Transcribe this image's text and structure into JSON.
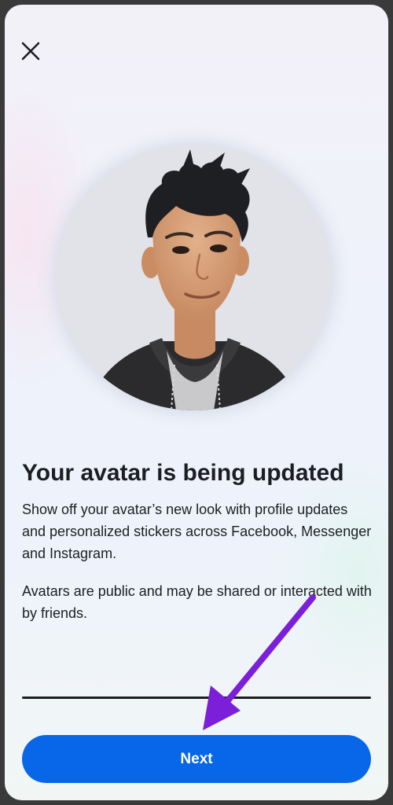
{
  "header": {
    "close_icon": "close-icon"
  },
  "avatar": {
    "image": "avatar-illustration"
  },
  "content": {
    "title": "Your avatar is being updated",
    "description": "Show off your avatar’s new look with profile updates and personalized stickers across Facebook, Messenger and Instagram.",
    "notice": "Avatars are public and may be shared or interacted with by friends."
  },
  "footer": {
    "next_label": "Next"
  },
  "colors": {
    "primary": "#0866e8",
    "text": "#1c1e21",
    "arrow": "#7b1fd9"
  }
}
